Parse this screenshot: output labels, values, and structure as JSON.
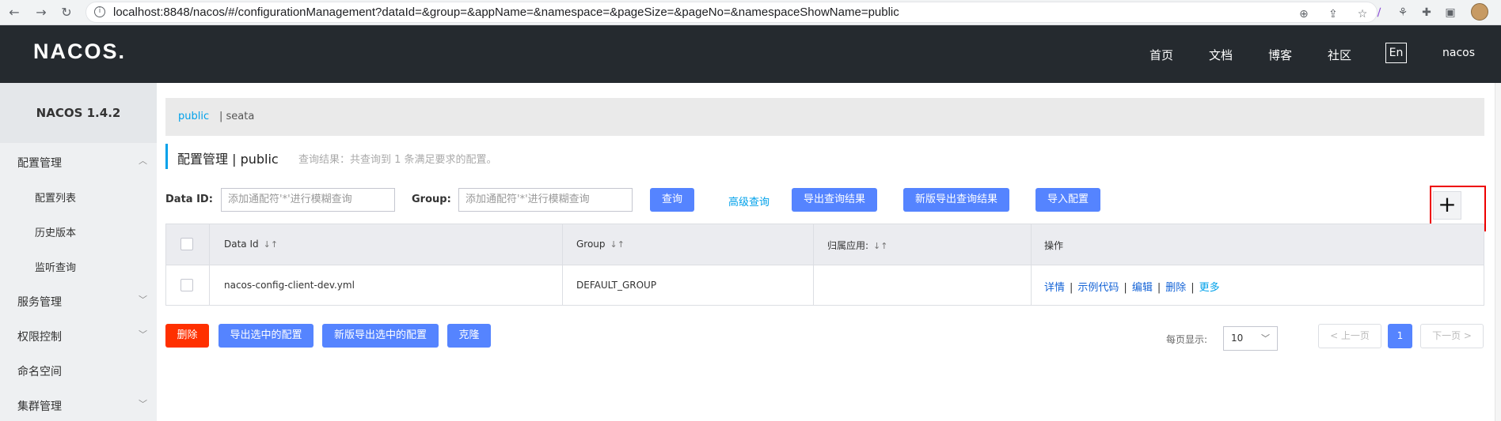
{
  "browser": {
    "url": "localhost:8848/nacos/#/configurationManagement?dataId=&group=&appName=&namespace=&pageSize=&pageNo=&namespaceShowName=public"
  },
  "topnav": {
    "logo": "NACOS.",
    "items": [
      "首页",
      "文档",
      "博客",
      "社区"
    ],
    "lang": "En",
    "user": "nacos"
  },
  "sidebar": {
    "version": "NACOS 1.4.2",
    "items": [
      {
        "label": "配置管理"
      },
      {
        "label": "配置列表"
      },
      {
        "label": "历史版本"
      },
      {
        "label": "监听查询"
      },
      {
        "label": "服务管理"
      },
      {
        "label": "权限控制"
      },
      {
        "label": "命名空间"
      },
      {
        "label": "集群管理"
      }
    ]
  },
  "namespaces": {
    "public": "public",
    "seata": "| seata"
  },
  "header": {
    "title": "配置管理 | public",
    "result": "查询结果：共查询到 1 条满足要求的配置。"
  },
  "filters": {
    "dataid_label": "Data ID:",
    "dataid_placeholder": "添加通配符'*'进行模糊查询",
    "group_label": "Group:",
    "group_placeholder": "添加通配符'*'进行模糊查询"
  },
  "toolbar": {
    "query": "查询",
    "advanced": "高级查询",
    "export_results": "导出查询结果",
    "new_export_results": "新版导出查询结果",
    "import": "导入配置",
    "add": "+"
  },
  "table": {
    "headers": [
      "Data Id",
      "Group",
      "归属应用:",
      "操作"
    ],
    "rows": [
      {
        "data_id": "nacos-config-client-dev.yml",
        "group": "DEFAULT_GROUP",
        "app": "",
        "ops": [
          "详情",
          "示例代码",
          "编辑",
          "删除",
          "更多"
        ]
      }
    ]
  },
  "bottom": {
    "delete": "删除",
    "export_selected": "导出选中的配置",
    "new_export_selected": "新版导出选中的配置",
    "clone": "克隆",
    "per_page_label": "每页显示:",
    "page_size": "10",
    "prev": "< 上一页",
    "current_page": "1",
    "next": "下一页 >"
  },
  "colors": {
    "primary": "#5584ff",
    "danger": "#ff3000",
    "topbar": "#252a2f",
    "link": "#00a1ea",
    "highlight_box": "#ee0000"
  }
}
